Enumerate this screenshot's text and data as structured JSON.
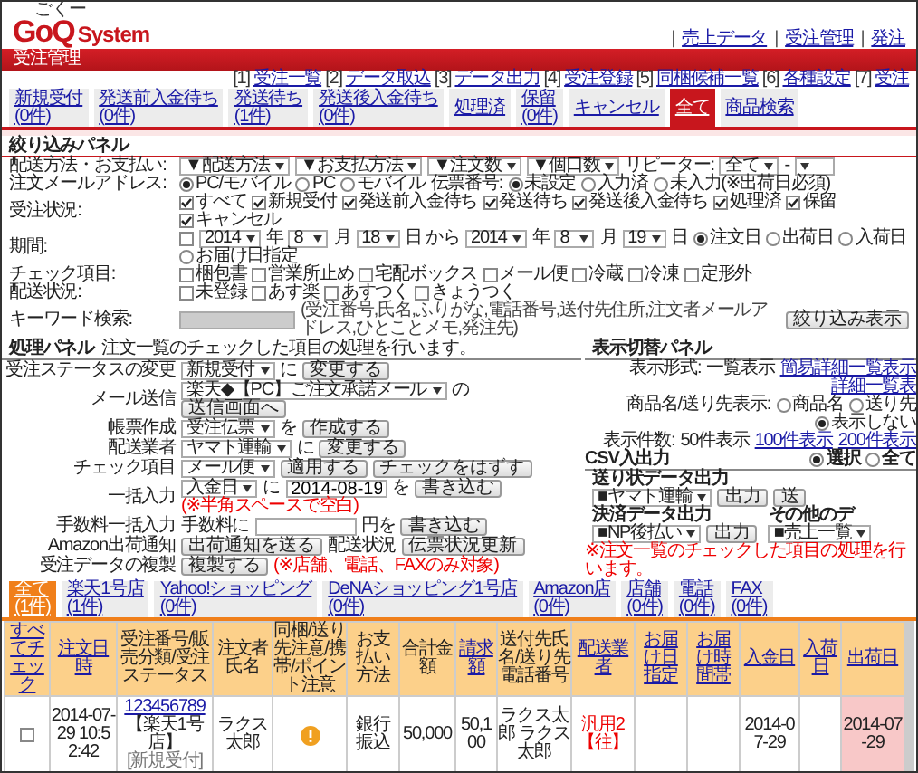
{
  "logo": {
    "ruby": "ごくー",
    "brand": "GoQ",
    "product": "System"
  },
  "top_links": [
    {
      "sep": "|",
      "label": "売上データ"
    },
    {
      "sep": "|",
      "label": "受注管理"
    },
    {
      "sep": "|",
      "label": "発注"
    }
  ],
  "title_bar": "受注管理",
  "sub_nav": [
    {
      "num": "[1]",
      "label": "受注一覧"
    },
    {
      "num": "[2]",
      "label": "データ取込"
    },
    {
      "num": "[3]",
      "label": "データ出力"
    },
    {
      "num": "[4]",
      "label": "受注登録"
    },
    {
      "num": "[5]",
      "label": "同梱候補一覧"
    },
    {
      "num": "[6]",
      "label": "各種設定"
    },
    {
      "num": "[7]",
      "label": "受注"
    }
  ],
  "tabs": [
    {
      "label": "新規受付",
      "count": "(0件)",
      "selected": false
    },
    {
      "label": "発送前入金待ち",
      "count": "(0件)",
      "selected": false
    },
    {
      "label": "発送待ち",
      "count": "(1件)",
      "selected": false
    },
    {
      "label": "発送後入金待ち",
      "count": "(0件)",
      "selected": false
    },
    {
      "label": "処理済",
      "selected": false
    },
    {
      "label": "保留",
      "count": "(0件)",
      "selected": false
    },
    {
      "label": "キャンセル",
      "selected": false
    },
    {
      "label": "全て",
      "selected": true
    },
    {
      "label": "商品検索",
      "selected": false
    }
  ],
  "filter_panel": {
    "title": "絞り込みパネル",
    "rows": [
      {
        "label": "配送方法・お支払い:",
        "controls": [
          {
            "kind": "select",
            "value": "▼配送方法"
          },
          {
            "kind": "select",
            "value": "▼お支払方法"
          },
          {
            "kind": "select",
            "value": "▼注文数"
          },
          {
            "kind": "select",
            "value": "▼個口数"
          },
          {
            "kind": "label",
            "text": "リピーター:"
          },
          {
            "kind": "select",
            "value": "全て"
          },
          {
            "kind": "text",
            "text": "-"
          },
          {
            "kind": "select"
          }
        ]
      },
      {
        "label": "注文メールアドレス:",
        "controls": [
          {
            "kind": "radio",
            "label": "PC/モバイル",
            "selected": true
          },
          {
            "kind": "radio",
            "label": "PC",
            "selected": false
          },
          {
            "kind": "radio",
            "label": "モバイル",
            "selected": false
          },
          {
            "kind": "label",
            "text": "伝票番号:"
          },
          {
            "kind": "radio",
            "label": "未設定",
            "selected": true
          },
          {
            "kind": "radio",
            "label": "入力済",
            "selected": false
          },
          {
            "kind": "radio",
            "label": "未入力(※出荷日必須)",
            "selected": false
          }
        ]
      },
      {
        "label": "受注状況:",
        "controls": [
          {
            "kind": "checkbox",
            "label": "すべて",
            "checked": true
          },
          {
            "kind": "checkbox",
            "label": "新規受付",
            "checked": true
          },
          {
            "kind": "checkbox",
            "label": "発送前入金待ち",
            "checked": true
          },
          {
            "kind": "checkbox",
            "label": "発送待ち",
            "checked": true
          },
          {
            "kind": "checkbox",
            "label": "発送後入金待ち",
            "checked": true
          },
          {
            "kind": "checkbox",
            "label": "処理済",
            "checked": true
          },
          {
            "kind": "checkbox",
            "label": "保留",
            "checked": true
          },
          {
            "kind": "checkbox",
            "label": "キャンセル",
            "checked": true
          }
        ]
      },
      {
        "label": "期間:",
        "controls": [
          {
            "kind": "checkbox",
            "checked": false
          },
          {
            "kind": "select",
            "value": "2014"
          },
          {
            "kind": "text",
            "text": "年"
          },
          {
            "kind": "select",
            "value": "8"
          },
          {
            "kind": "text",
            "text": "月"
          },
          {
            "kind": "select",
            "value": "18"
          },
          {
            "kind": "text",
            "text": "日 から"
          },
          {
            "kind": "select",
            "value": "2014"
          },
          {
            "kind": "text",
            "text": "年"
          },
          {
            "kind": "select",
            "value": "8"
          },
          {
            "kind": "text",
            "text": "月"
          },
          {
            "kind": "select",
            "value": "19"
          },
          {
            "kind": "text",
            "text": "日"
          },
          {
            "kind": "radio",
            "label": "注文日",
            "selected": true
          },
          {
            "kind": "radio",
            "label": "出荷日",
            "selected": false
          },
          {
            "kind": "radio",
            "label": "入荷日",
            "selected": false
          },
          {
            "kind": "radio",
            "label": "お届け日指定",
            "selected": false
          }
        ]
      },
      {
        "label": "チェック項目:",
        "controls": [
          {
            "kind": "checkbox",
            "label": "梱包書",
            "checked": false
          },
          {
            "kind": "checkbox",
            "label": "営業所止め",
            "checked": false
          },
          {
            "kind": "checkbox",
            "label": "宅配ボックス",
            "checked": false
          },
          {
            "kind": "checkbox",
            "label": "メール便",
            "checked": false
          },
          {
            "kind": "checkbox",
            "label": "冷蔵",
            "checked": false
          },
          {
            "kind": "checkbox",
            "label": "冷凍",
            "checked": false
          },
          {
            "kind": "checkbox",
            "label": "定形外",
            "checked": false
          }
        ]
      },
      {
        "label": "配送状況:",
        "controls": [
          {
            "kind": "checkbox",
            "label": "未登録",
            "checked": false
          },
          {
            "kind": "checkbox",
            "label": "あす楽",
            "checked": false
          },
          {
            "kind": "checkbox",
            "label": "あすつく",
            "checked": false
          },
          {
            "kind": "checkbox",
            "label": "きょうつく",
            "checked": false
          }
        ]
      },
      {
        "label": "キーワード検索:",
        "controls": [
          {
            "kind": "input"
          },
          {
            "kind": "hint",
            "text": "(受注番号,氏名,ふりがな,電話番号,送付先住所,注文者メールアドレス,ひとことメモ,発注先)"
          },
          {
            "kind": "button",
            "label": "絞り込み表示"
          }
        ]
      }
    ]
  },
  "process_panel": {
    "title": "処理パネル",
    "description": "注文一覧のチェックした項目の処理を行います。",
    "rows": [
      {
        "label": "受注ステータスの変更",
        "controls": [
          {
            "kind": "select",
            "value": "新規受付"
          },
          {
            "kind": "text",
            "text": "に"
          },
          {
            "kind": "button",
            "label": "変更する"
          }
        ]
      },
      {
        "label": "メール送信",
        "controls": [
          {
            "kind": "select",
            "value": "楽天◆【PC】ご注文承諾メール"
          },
          {
            "kind": "text",
            "text": "の"
          },
          {
            "kind": "button",
            "label": "送信画面へ"
          }
        ]
      },
      {
        "label": "帳票作成",
        "controls": [
          {
            "kind": "select",
            "value": "受注伝票"
          },
          {
            "kind": "text",
            "text": "を"
          },
          {
            "kind": "button",
            "label": "作成する"
          }
        ]
      },
      {
        "label": "配送業者",
        "controls": [
          {
            "kind": "select",
            "value": "ヤマト運輸"
          },
          {
            "kind": "text",
            "text": "に"
          },
          {
            "kind": "button",
            "label": "変更する"
          }
        ]
      },
      {
        "label": "チェック項目",
        "controls": [
          {
            "kind": "select",
            "value": "メール便"
          },
          {
            "kind": "button",
            "label": "適用する"
          },
          {
            "kind": "button",
            "label": "チェックをはずす"
          }
        ]
      },
      {
        "label": "一括入力",
        "controls": [
          {
            "kind": "select",
            "value": "入金日"
          },
          {
            "kind": "text",
            "text": "に"
          },
          {
            "kind": "input",
            "value": "2014-08-19"
          },
          {
            "kind": "text",
            "text": "を"
          },
          {
            "kind": "button",
            "label": "書き込む"
          },
          {
            "kind": "note",
            "text": "(※半角スペースで空白)"
          }
        ]
      },
      {
        "label": "手数料一括入力",
        "controls": [
          {
            "kind": "text",
            "text": "手数料に"
          },
          {
            "kind": "input"
          },
          {
            "kind": "text",
            "text": "円を"
          },
          {
            "kind": "button",
            "label": "書き込む"
          }
        ]
      },
      {
        "label": "Amazon出荷通知",
        "controls": [
          {
            "kind": "button",
            "label": "出荷通知を送る"
          },
          {
            "kind": "label",
            "text": "配送状況"
          },
          {
            "kind": "button",
            "label": "伝票状況更新"
          }
        ]
      },
      {
        "label": "受注データの複製",
        "controls": [
          {
            "kind": "button",
            "label": "複製する"
          },
          {
            "kind": "note",
            "text": "(※店舗、電話、FAXのみ対象)"
          }
        ]
      }
    ]
  },
  "display_panel": {
    "title": "表示切替パネル",
    "rows": [
      {
        "label": "表示形式:",
        "controls": [
          {
            "kind": "text",
            "text": "一覧表示"
          },
          {
            "kind": "link",
            "label": "簡易詳細一覧表示"
          },
          {
            "kind": "link",
            "label": "詳細一覧表"
          }
        ]
      },
      {
        "label": "商品名/送り先表示:",
        "controls": [
          {
            "kind": "radio",
            "label": "商品名",
            "selected": false
          },
          {
            "kind": "radio",
            "label": "送り先",
            "selected": false
          },
          {
            "kind": "radio",
            "label": "表示しない",
            "selected": true
          }
        ]
      },
      {
        "label": "表示件数:",
        "controls": [
          {
            "kind": "text",
            "text": "50件表示"
          },
          {
            "kind": "link",
            "label": "100件表示"
          },
          {
            "kind": "link",
            "label": "200件表示"
          }
        ]
      }
    ]
  },
  "csv_panel": {
    "title": "CSV入出力",
    "options": [
      {
        "label": "選択",
        "selected": true
      },
      {
        "label": "全て",
        "selected": false
      }
    ],
    "blocks": [
      {
        "title": "送り状データ出力",
        "select": "■ヤマト運輸",
        "buttons": [
          "出力",
          "送"
        ]
      },
      {
        "title": "決済データ出力",
        "select": "■NP後払い",
        "buttons": [
          "出力"
        ]
      },
      {
        "title": "その他のデ",
        "select": "■売上一覧"
      }
    ],
    "note": "※注文一覧のチェックした項目の処理を行います。"
  },
  "store_tabs": [
    {
      "label": "全て",
      "count": "(1件)",
      "selected": true
    },
    {
      "label": "楽天1号店",
      "count": "(1件)",
      "selected": false
    },
    {
      "label": "Yahoo!ショッピング",
      "count": "(0件)",
      "selected": false
    },
    {
      "label": "DeNAショッピング1号店",
      "count": "(0件)",
      "selected": false
    },
    {
      "label": "Amazon店",
      "count": "(0件)",
      "selected": false
    },
    {
      "label": "店舗",
      "count": "(0件)",
      "selected": false
    },
    {
      "label": "電話",
      "count": "(0件)",
      "selected": false
    },
    {
      "label": "FAX",
      "count": "(0件)",
      "selected": false
    }
  ],
  "table": {
    "columns": [
      {
        "label": "すべてチェック",
        "sortable": true
      },
      {
        "label": "注文日時",
        "sortable": true
      },
      {
        "label": "受注番号/販売分類/受注ステータス",
        "sortable": false
      },
      {
        "label": "注文者氏名",
        "sortable": false
      },
      {
        "label": "同梱/送り先注意/携帯/ポイント注意",
        "sortable": false
      },
      {
        "label": "お支払い方法",
        "sortable": false
      },
      {
        "label": "合計金額",
        "sortable": false
      },
      {
        "label": "請求額",
        "sortable": true
      },
      {
        "label": "送付先氏名/送り先電話番号",
        "sortable": false
      },
      {
        "label": "配送業者",
        "sortable": true
      },
      {
        "label": "お届け日指定",
        "sortable": true
      },
      {
        "label": "お届け時間帯",
        "sortable": true
      },
      {
        "label": "入金日",
        "sortable": true
      },
      {
        "label": "入荷日",
        "sortable": true
      },
      {
        "label": "出荷日",
        "sortable": true
      }
    ],
    "rows": [
      {
        "checked": false,
        "ordered": "2014-07-29 10:52:42",
        "order_no": "123456789",
        "shop": "【楽天1号店】",
        "status": "[新規受付]",
        "customer": "ラクス太郎",
        "warning": true,
        "payment": "銀行振込",
        "total": "50,000",
        "billed": "50,100",
        "recipient": "ラクス太郎 ラクス太郎",
        "carrier": "汎用2【往】",
        "paid_on": "2014-07-29",
        "shipped_on": "2014-07-29"
      }
    ]
  }
}
